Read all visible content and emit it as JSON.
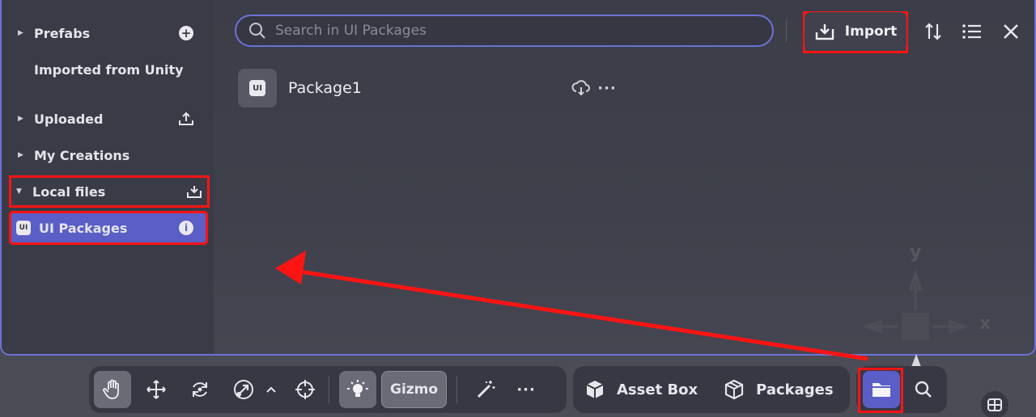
{
  "sidebar": {
    "items": [
      {
        "label": "Prefabs"
      },
      {
        "label": "Imported from Unity"
      },
      {
        "label": "Uploaded"
      },
      {
        "label": "My Creations"
      },
      {
        "label": "Local files"
      },
      {
        "label": "UI Packages"
      }
    ]
  },
  "search": {
    "placeholder": "Search in UI Packages"
  },
  "header": {
    "import_label": "Import"
  },
  "packages": [
    {
      "name": "Package1"
    }
  ],
  "viewport": {
    "axis_y": "y",
    "axis_x": "x"
  },
  "toolbar": {
    "gizmo_label": "Gizmo",
    "asset_box_label": "Asset Box",
    "packages_label": "Packages"
  },
  "package_icon_text": "UI",
  "colors": {
    "accent": "#5a5ec6",
    "highlight": "#ff1414",
    "panel_border": "#6d72d8"
  }
}
